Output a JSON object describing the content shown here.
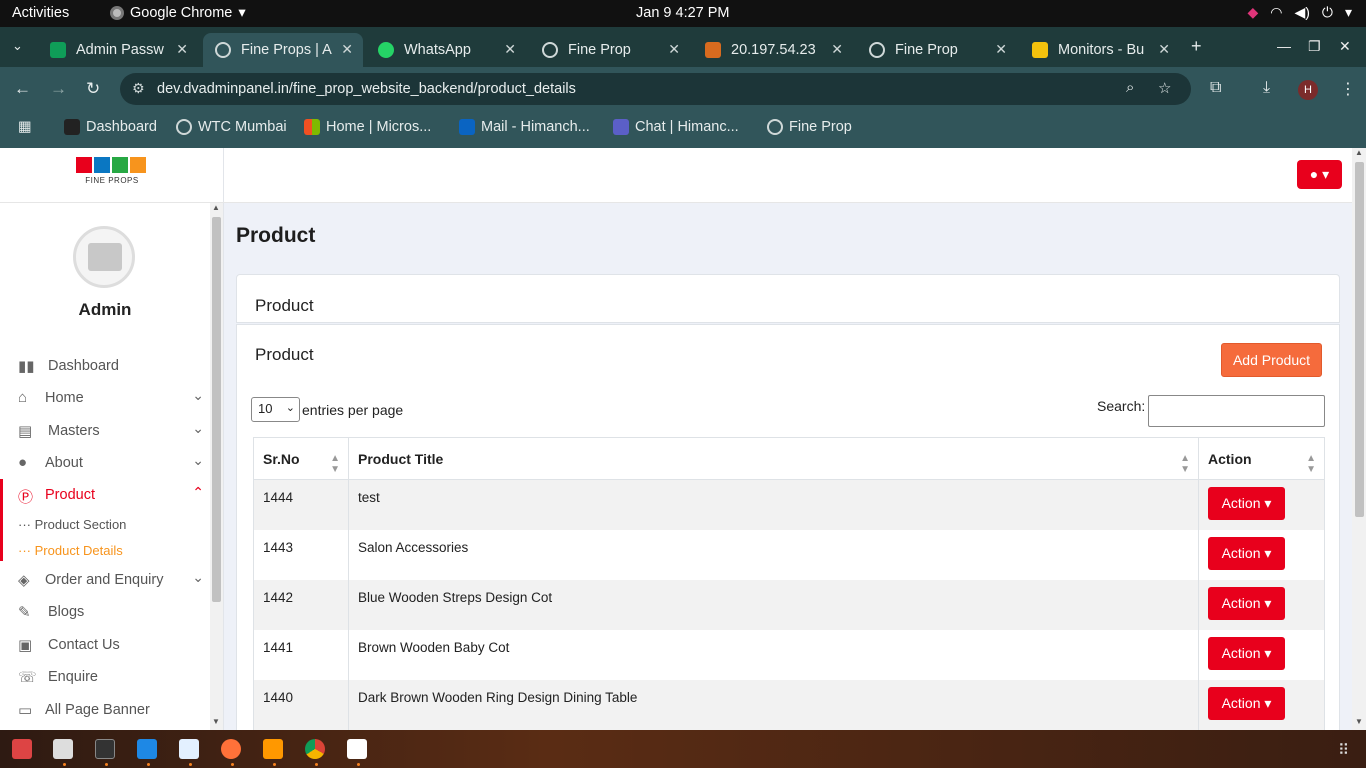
{
  "os": {
    "activities": "Activities",
    "app_name": "Google Chrome",
    "clock": "Jan 9   4:27 PM"
  },
  "tabs": [
    {
      "label": "Admin Passw",
      "active": false
    },
    {
      "label": "Fine Props | A",
      "active": true
    },
    {
      "label": "WhatsApp",
      "active": false
    },
    {
      "label": "Fine Prop",
      "active": false
    },
    {
      "label": "20.197.54.23",
      "active": false
    },
    {
      "label": "Fine Prop",
      "active": false
    },
    {
      "label": "Monitors - Bu",
      "active": false
    }
  ],
  "address": {
    "url": "dev.dvadminpanel.in/fine_prop_website_backend/product_details",
    "profile_initial": "H"
  },
  "bookmarks": [
    {
      "label": "Dashboard"
    },
    {
      "label": "WTC Mumbai"
    },
    {
      "label": "Home | Micros..."
    },
    {
      "label": "Mail - Himanch..."
    },
    {
      "label": "Chat | Himanc..."
    },
    {
      "label": "Fine Prop"
    }
  ],
  "sidebar": {
    "logo_text": "FINE PROPS",
    "user_name": "Admin",
    "items": [
      {
        "label": "Dashboard",
        "icon": "bar-chart-icon",
        "chevron": false
      },
      {
        "label": "Home",
        "icon": "home-icon",
        "chevron": true
      },
      {
        "label": "Masters",
        "icon": "table-icon",
        "chevron": true
      },
      {
        "label": "About",
        "icon": "user-icon",
        "chevron": true
      },
      {
        "label": "Product",
        "icon": "product-icon",
        "chevron": true,
        "active": true
      },
      {
        "label": "Order and Enquiry",
        "icon": "tag-icon",
        "chevron": true
      },
      {
        "label": "Blogs",
        "icon": "blog-icon",
        "chevron": false
      },
      {
        "label": "Contact Us",
        "icon": "contact-icon",
        "chevron": false
      },
      {
        "label": "Enquire",
        "icon": "phone-icon",
        "chevron": false
      },
      {
        "label": "All Page Banner",
        "icon": "image-icon",
        "chevron": false
      }
    ],
    "sub_items": [
      {
        "label": "Product Section"
      },
      {
        "label": "Product Details"
      }
    ]
  },
  "main": {
    "page_title": "Product",
    "card_header": "Product",
    "section_title": "Product",
    "add_button": "Add Product",
    "entries_value": "10",
    "entries_label": "entries per page",
    "search_label": "Search:",
    "search_value": "",
    "columns": [
      "Sr.No",
      "Product Title",
      "Action"
    ],
    "action_label": "Action",
    "rows": [
      {
        "id": "1444",
        "title": "test"
      },
      {
        "id": "1443",
        "title": "Salon Accessories"
      },
      {
        "id": "1442",
        "title": "Blue Wooden Streps Design Cot"
      },
      {
        "id": "1441",
        "title": "Brown Wooden Baby Cot"
      },
      {
        "id": "1440",
        "title": "Dark Brown Wooden Ring Design Dining Table"
      }
    ]
  },
  "colors": {
    "accent_red": "#e8001c",
    "accent_orange": "#f56b3c",
    "current_sub": "#f7941d"
  }
}
